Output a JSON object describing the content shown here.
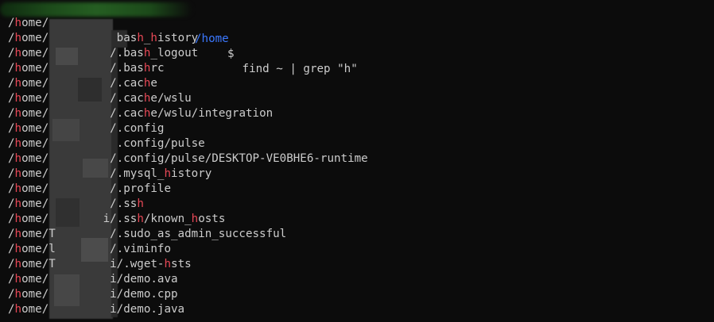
{
  "prompt": {
    "path": "/home",
    "symbol": "$",
    "command": " find ~ | grep \"h\""
  },
  "colors": {
    "background": "#0c0c0c",
    "text": "#cccccc",
    "path": "#3b78ff",
    "match": "#e74856"
  },
  "lines": [
    [
      [
        "/"
      ],
      [
        "h",
        "hl"
      ],
      [
        "ome/"
      ]
    ],
    [
      [
        "/"
      ],
      [
        "h",
        "hl"
      ],
      [
        "ome/"
      ],
      [
        "          bas"
      ],
      [
        "h",
        "hl"
      ],
      [
        "_"
      ],
      [
        "h",
        "hl"
      ],
      [
        "istory"
      ]
    ],
    [
      [
        "/"
      ],
      [
        "h",
        "hl"
      ],
      [
        "ome/"
      ],
      [
        "         /.bas"
      ],
      [
        "h",
        "hl"
      ],
      [
        "_logout"
      ]
    ],
    [
      [
        "/"
      ],
      [
        "h",
        "hl"
      ],
      [
        "ome/"
      ],
      [
        "         /.bas"
      ],
      [
        "h",
        "hl"
      ],
      [
        "rc"
      ]
    ],
    [
      [
        "/"
      ],
      [
        "h",
        "hl"
      ],
      [
        "ome/"
      ],
      [
        "         /.cac"
      ],
      [
        "h",
        "hl"
      ],
      [
        "e"
      ]
    ],
    [
      [
        "/"
      ],
      [
        "h",
        "hl"
      ],
      [
        "ome/"
      ],
      [
        "         /.cac"
      ],
      [
        "h",
        "hl"
      ],
      [
        "e/wslu"
      ]
    ],
    [
      [
        "/"
      ],
      [
        "h",
        "hl"
      ],
      [
        "ome/"
      ],
      [
        "         /.cac"
      ],
      [
        "h",
        "hl"
      ],
      [
        "e/wslu/integration"
      ]
    ],
    [
      [
        "/"
      ],
      [
        "h",
        "hl"
      ],
      [
        "ome/"
      ],
      [
        "         /.config"
      ]
    ],
    [
      [
        "/"
      ],
      [
        "h",
        "hl"
      ],
      [
        "ome/"
      ],
      [
        "          .config/pulse"
      ]
    ],
    [
      [
        "/"
      ],
      [
        "h",
        "hl"
      ],
      [
        "ome/"
      ],
      [
        "         /.config/pulse/DESKTOP-VE0BHE6-runtime"
      ]
    ],
    [
      [
        "/"
      ],
      [
        "h",
        "hl"
      ],
      [
        "ome/"
      ],
      [
        "         /.mysql_"
      ],
      [
        "h",
        "hl"
      ],
      [
        "istory"
      ]
    ],
    [
      [
        "/"
      ],
      [
        "h",
        "hl"
      ],
      [
        "ome/"
      ],
      [
        "         /.profile"
      ]
    ],
    [
      [
        "/"
      ],
      [
        "h",
        "hl"
      ],
      [
        "ome/"
      ],
      [
        "         /.ss"
      ],
      [
        "h",
        "hl"
      ]
    ],
    [
      [
        "/"
      ],
      [
        "h",
        "hl"
      ],
      [
        "ome/"
      ],
      [
        "        i/.ss"
      ],
      [
        "h",
        "hl"
      ],
      [
        "/known_"
      ],
      [
        "h",
        "hl"
      ],
      [
        "osts"
      ]
    ],
    [
      [
        "/"
      ],
      [
        "h",
        "hl"
      ],
      [
        "ome/T"
      ],
      [
        "        /.sudo_as_admin_successful"
      ]
    ],
    [
      [
        "/"
      ],
      [
        "h",
        "hl"
      ],
      [
        "ome/l"
      ],
      [
        "        /.viminfo"
      ]
    ],
    [
      [
        "/"
      ],
      [
        "h",
        "hl"
      ],
      [
        "ome/T"
      ],
      [
        "        i/.wget-"
      ],
      [
        "h",
        "hl"
      ],
      [
        "sts"
      ]
    ],
    [
      [
        "/"
      ],
      [
        "h",
        "hl"
      ],
      [
        "ome/"
      ],
      [
        "         i/demo.ava"
      ]
    ],
    [
      [
        "/"
      ],
      [
        "h",
        "hl"
      ],
      [
        "ome/"
      ],
      [
        "         i/demo.cpp"
      ]
    ],
    [
      [
        "/"
      ],
      [
        "h",
        "hl"
      ],
      [
        "ome/"
      ],
      [
        "         i/demo.java"
      ]
    ]
  ]
}
